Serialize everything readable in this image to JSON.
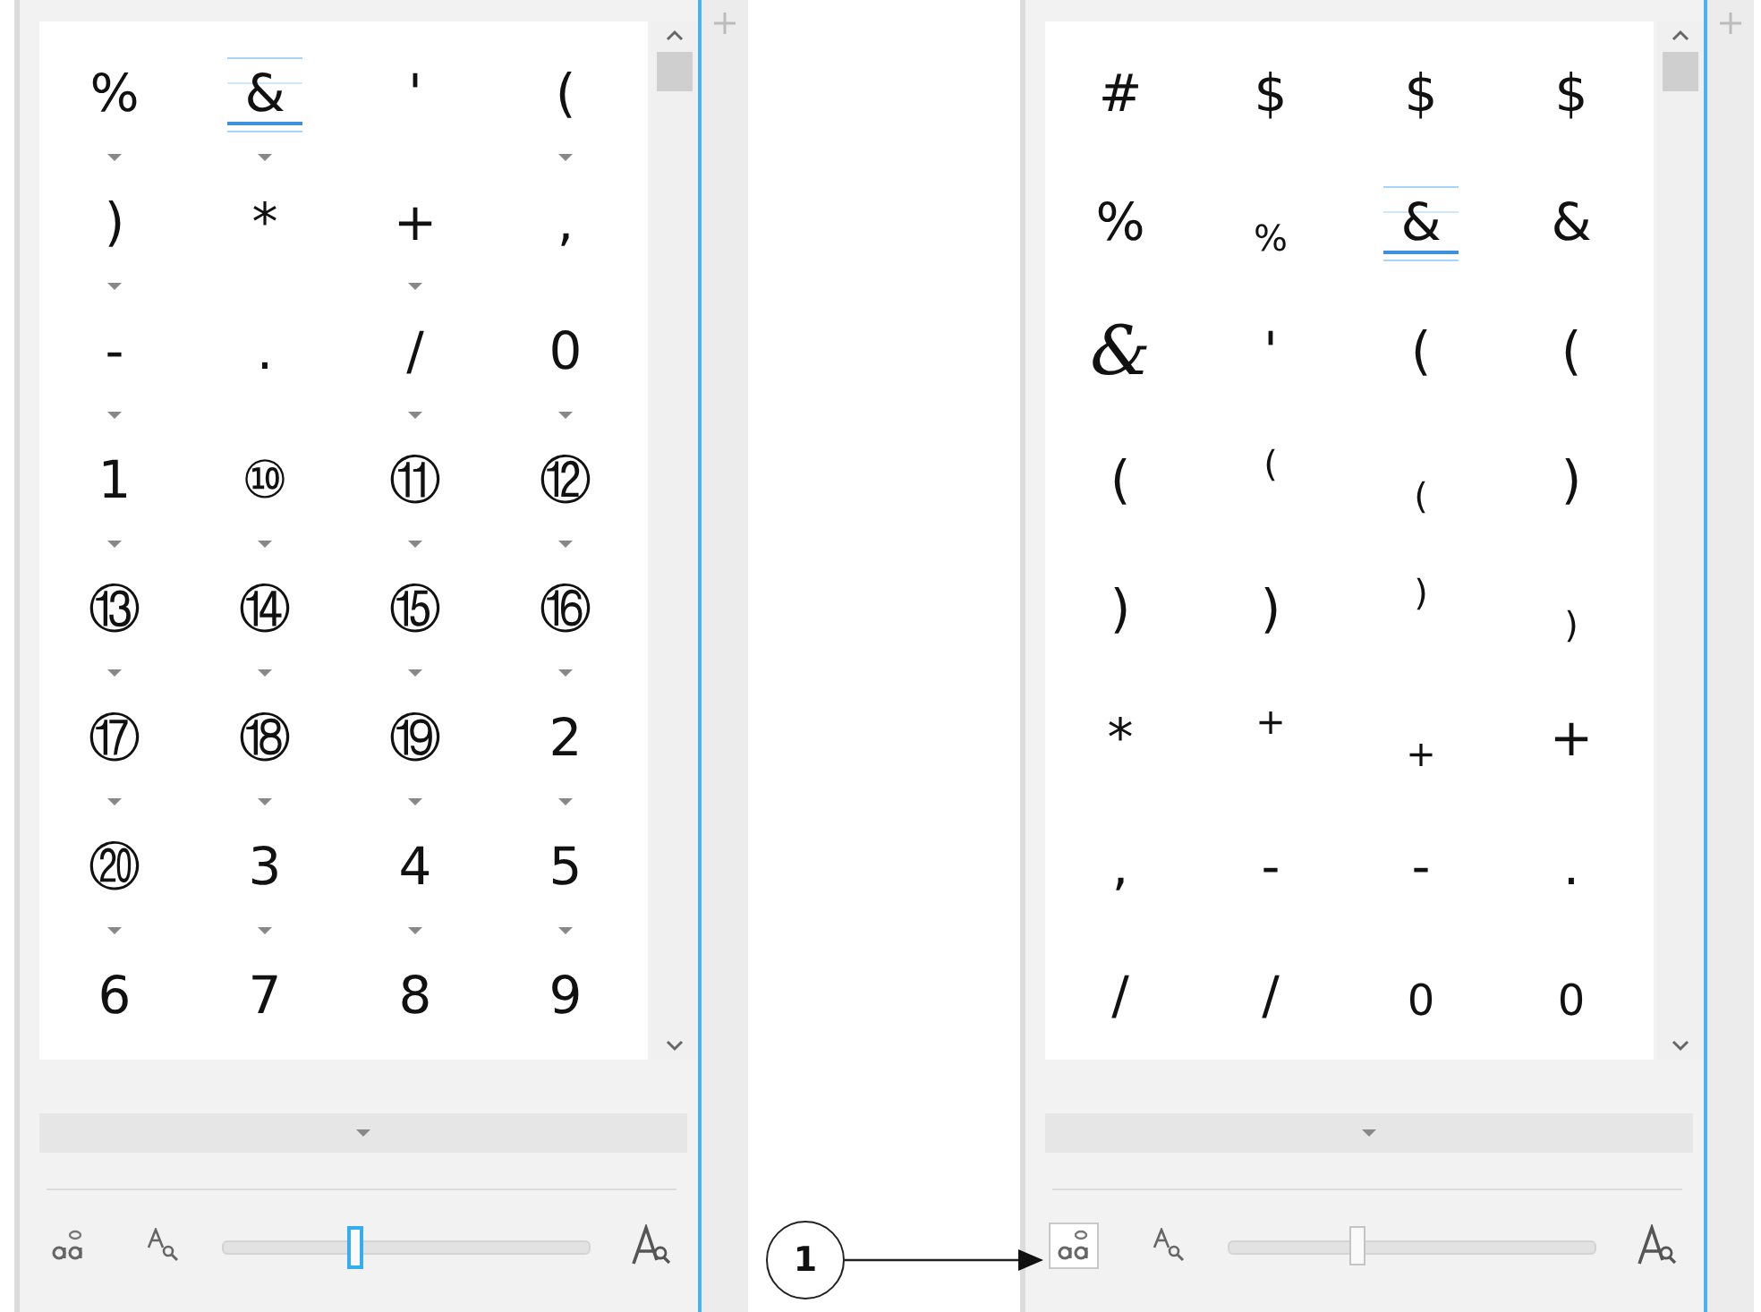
{
  "panels": [
    {
      "glyphs": [
        {
          "glyph": "%",
          "alternates": true,
          "selected": false
        },
        {
          "glyph": "&",
          "alternates": true,
          "selected": true
        },
        {
          "glyph": "'",
          "alternates": false,
          "selected": false
        },
        {
          "glyph": "(",
          "alternates": true,
          "selected": false
        },
        {
          "glyph": ")",
          "alternates": true,
          "selected": false
        },
        {
          "glyph": "*",
          "alternates": false,
          "selected": false
        },
        {
          "glyph": "+",
          "alternates": true,
          "selected": false
        },
        {
          "glyph": ",",
          "alternates": false,
          "selected": false
        },
        {
          "glyph": "-",
          "alternates": true,
          "selected": false
        },
        {
          "glyph": ".",
          "alternates": false,
          "selected": false
        },
        {
          "glyph": "/",
          "alternates": true,
          "selected": false
        },
        {
          "glyph": "0",
          "alternates": true,
          "selected": false
        },
        {
          "glyph": "1",
          "alternates": true,
          "selected": false
        },
        {
          "glyph": "⑩",
          "alternates": true,
          "selected": false
        },
        {
          "glyph": "⑪",
          "alternates": true,
          "selected": false
        },
        {
          "glyph": "⑫",
          "alternates": true,
          "selected": false
        },
        {
          "glyph": "⑬",
          "alternates": true,
          "selected": false
        },
        {
          "glyph": "⑭",
          "alternates": true,
          "selected": false
        },
        {
          "glyph": "⑮",
          "alternates": true,
          "selected": false
        },
        {
          "glyph": "⑯",
          "alternates": true,
          "selected": false
        },
        {
          "glyph": "⑰",
          "alternates": true,
          "selected": false
        },
        {
          "glyph": "⑱",
          "alternates": true,
          "selected": false
        },
        {
          "glyph": "⑲",
          "alternates": true,
          "selected": false
        },
        {
          "glyph": "2",
          "alternates": true,
          "selected": false
        },
        {
          "glyph": "⑳",
          "alternates": true,
          "selected": false
        },
        {
          "glyph": "3",
          "alternates": true,
          "selected": false
        },
        {
          "glyph": "4",
          "alternates": true,
          "selected": false
        },
        {
          "glyph": "5",
          "alternates": true,
          "selected": false
        },
        {
          "glyph": "6",
          "alternates": false,
          "selected": false
        },
        {
          "glyph": "7",
          "alternates": false,
          "selected": false
        },
        {
          "glyph": "8",
          "alternates": false,
          "selected": false
        },
        {
          "glyph": "9",
          "alternates": false,
          "selected": false
        }
      ],
      "alternates_button": {
        "pressed": false
      },
      "zoom_slider": {
        "level": 0.36,
        "focused": true
      }
    },
    {
      "glyphs": [
        {
          "glyph": "#",
          "selected": false,
          "kind": "regular"
        },
        {
          "glyph": "$",
          "selected": false,
          "kind": "regular"
        },
        {
          "glyph": "$",
          "selected": false,
          "kind": "regular"
        },
        {
          "glyph": "$",
          "selected": false,
          "kind": "regular"
        },
        {
          "glyph": "%",
          "selected": false,
          "kind": "regular"
        },
        {
          "glyph": "%",
          "selected": false,
          "kind": "subscript"
        },
        {
          "glyph": "&",
          "selected": true,
          "kind": "regular"
        },
        {
          "glyph": "&",
          "selected": false,
          "kind": "regular"
        },
        {
          "glyph": "&",
          "selected": false,
          "kind": "swash"
        },
        {
          "glyph": "'",
          "selected": false,
          "kind": "regular"
        },
        {
          "glyph": "(",
          "selected": false,
          "kind": "regular"
        },
        {
          "glyph": "(",
          "selected": false,
          "kind": "regular"
        },
        {
          "glyph": "(",
          "selected": false,
          "kind": "regular"
        },
        {
          "glyph": "(",
          "selected": false,
          "kind": "superscript"
        },
        {
          "glyph": "(",
          "selected": false,
          "kind": "subscript"
        },
        {
          "glyph": ")",
          "selected": false,
          "kind": "regular"
        },
        {
          "glyph": ")",
          "selected": false,
          "kind": "regular"
        },
        {
          "glyph": ")",
          "selected": false,
          "kind": "regular"
        },
        {
          "glyph": ")",
          "selected": false,
          "kind": "superscript"
        },
        {
          "glyph": ")",
          "selected": false,
          "kind": "subscript"
        },
        {
          "glyph": "*",
          "selected": false,
          "kind": "regular"
        },
        {
          "glyph": "+",
          "selected": false,
          "kind": "superscript"
        },
        {
          "glyph": "+",
          "selected": false,
          "kind": "subscript"
        },
        {
          "glyph": "+",
          "selected": false,
          "kind": "regular"
        },
        {
          "glyph": ",",
          "selected": false,
          "kind": "regular"
        },
        {
          "glyph": "-",
          "selected": false,
          "kind": "regular"
        },
        {
          "glyph": "-",
          "selected": false,
          "kind": "regular"
        },
        {
          "glyph": ".",
          "selected": false,
          "kind": "regular"
        },
        {
          "glyph": "/",
          "selected": false,
          "kind": "regular"
        },
        {
          "glyph": "/",
          "selected": false,
          "kind": "regular"
        },
        {
          "glyph": "0",
          "selected": false,
          "kind": "oldstyle"
        },
        {
          "glyph": "0",
          "selected": false,
          "kind": "oldstyle"
        }
      ],
      "alternates_button": {
        "pressed": true
      },
      "zoom_slider": {
        "level": 0.35,
        "focused": false
      }
    }
  ],
  "callout": {
    "number": "1"
  }
}
